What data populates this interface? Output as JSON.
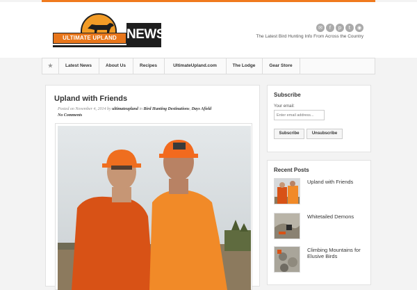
{
  "brand": {
    "logo_banner_text": "ULTIMATE UPLAND",
    "logo_news_text": "NEWS",
    "tagline": "The Latest Bird Hunting Info From Across the Country",
    "accent": "#f07a1e"
  },
  "social": [
    {
      "icon": "email-icon",
      "glyph": "✉"
    },
    {
      "icon": "facebook-icon",
      "glyph": "f"
    },
    {
      "icon": "pinterest-icon",
      "glyph": "p"
    },
    {
      "icon": "twitter-icon",
      "glyph": "t"
    },
    {
      "icon": "rss-icon",
      "glyph": "◉"
    }
  ],
  "nav": {
    "home_icon": "★",
    "items": [
      "Latest News",
      "About Us",
      "Recipes",
      "UltimateUpland.com",
      "The Lodge",
      "Gear Store"
    ]
  },
  "post": {
    "title": "Upland with Friends",
    "posted_on": "Posted on November 4, 2014",
    "by": "by",
    "author": "ultimateupland",
    "in": "in",
    "category1": "Bird Hunting Destinations",
    "sep": ",",
    "category2": "Days Afield",
    "comments": "No Comments"
  },
  "subscribe": {
    "title": "Subscribe",
    "email_label": "Your email:",
    "email_placeholder": "Enter email address...",
    "subscribe_button": "Subscribe",
    "unsubscribe_button": "Unsubscribe"
  },
  "recent": {
    "title": "Recent Posts",
    "items": [
      {
        "title": "Upland with Friends"
      },
      {
        "title": "Whitetailed Demons"
      },
      {
        "title": "Climbing Mountains for Elusive Birds"
      }
    ]
  }
}
